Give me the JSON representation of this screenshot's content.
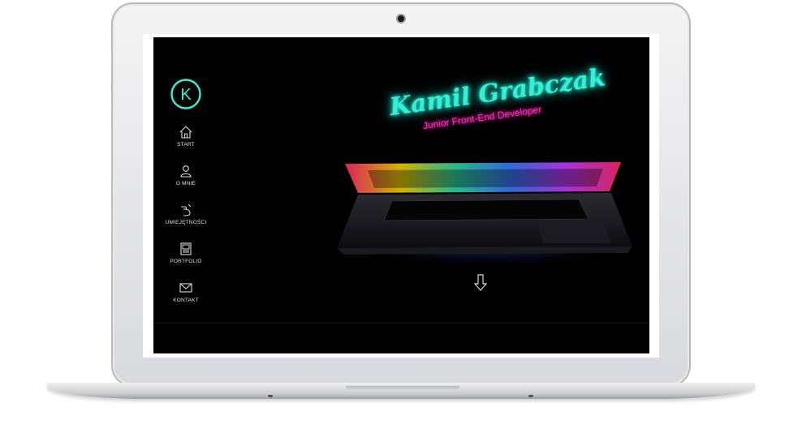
{
  "site": {
    "logo_letter": "K",
    "title": "Kamil Grabczak",
    "subtitle": "Junior Front-End Developer"
  },
  "nav": {
    "items": [
      {
        "label": "START",
        "icon": "home-icon"
      },
      {
        "label": "O MNIE",
        "icon": "user-icon"
      },
      {
        "label": "UMIEJĘTNOŚCI",
        "icon": "skills-icon"
      },
      {
        "label": "PORTFOLIO",
        "icon": "portfolio-icon"
      },
      {
        "label": "KONTAKT",
        "icon": "envelope-icon"
      }
    ]
  },
  "colors": {
    "neon_cyan": "#33f0d6",
    "neon_pink": "#ff2fbd",
    "background": "#000000"
  },
  "hero_image": "laptop-rgb-keyboard",
  "scroll_icon": "arrow-down-icon"
}
